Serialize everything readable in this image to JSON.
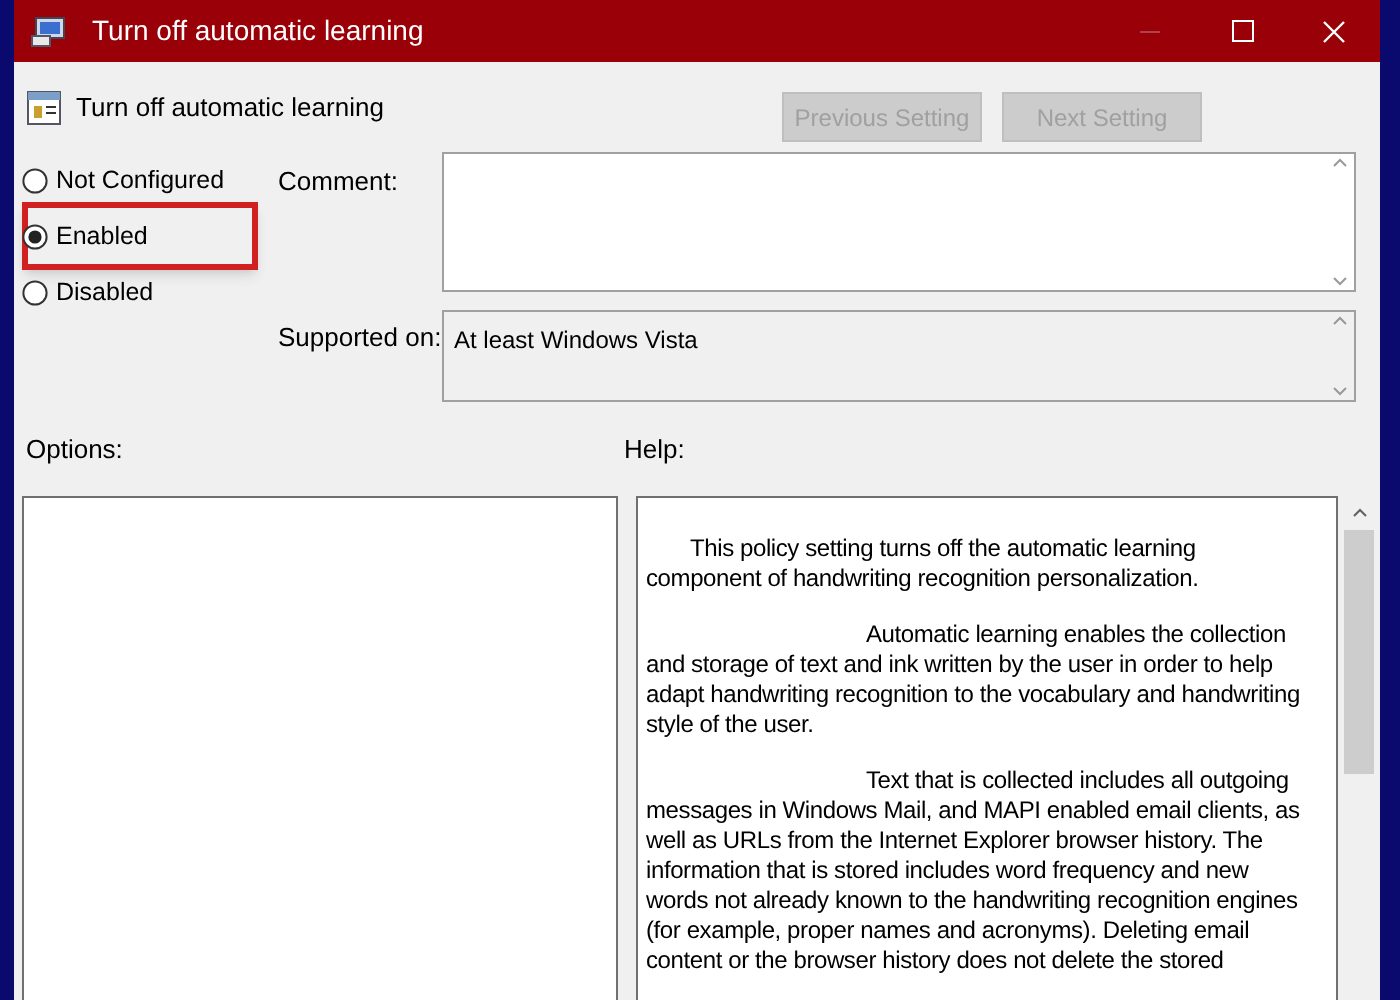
{
  "window": {
    "title": "Turn off automatic learning"
  },
  "header": {
    "setting_name": "Turn off automatic learning",
    "buttons": [
      {
        "label": "Previous Setting",
        "disabled": true
      },
      {
        "label": "Next Setting",
        "disabled": true
      }
    ]
  },
  "state_options": [
    {
      "label": "Not Configured",
      "selected": false,
      "highlighted": false
    },
    {
      "label": "Enabled",
      "selected": true,
      "highlighted": true
    },
    {
      "label": "Disabled",
      "selected": false,
      "highlighted": false
    }
  ],
  "comment": {
    "label": "Comment:"
  },
  "supported_on": {
    "label": "Supported on:",
    "value": "At least Windows Vista"
  },
  "options": {
    "label": "Options:"
  },
  "help": {
    "label": "Help:",
    "paragraphs": [
      "This policy setting turns off the automatic learning component of handwriting recognition personalization.",
      "Automatic learning enables the collection and storage of text and ink written by the user in order to help adapt handwriting recognition to the vocabulary and handwriting style of the user.",
      "Text that is collected includes all outgoing messages in Windows Mail, and MAPI enabled email clients, as well as URLs from the Internet Explorer browser history. The information that is stored includes word frequency and new words not already known to the handwriting recognition engines (for example, proper names and acronyms). Deleting email content or the browser history does not delete the stored"
    ]
  }
}
